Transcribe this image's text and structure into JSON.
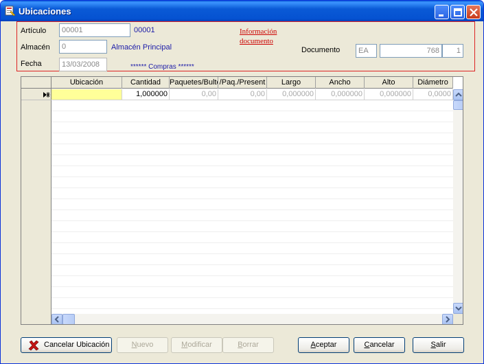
{
  "window": {
    "title": "Ubicaciones"
  },
  "header": {
    "articulo_label": "Artículo",
    "articulo_value": "00001",
    "articulo_desc": "00001",
    "almacen_label": "Almacén",
    "almacen_value": "0",
    "almacen_desc": "Almacén Principal",
    "fecha_label": "Fecha",
    "fecha_value": "13/03/2008",
    "tipo_desc": "****** Compras ******",
    "info_link_line1": "Información",
    "info_link_line2": "documento",
    "documento_label": "Documento",
    "doc_serie": "EA",
    "doc_numero": "768",
    "doc_linea": "1"
  },
  "grid": {
    "columns": [
      "Ubicación",
      "Cantidad",
      "Paquetes/Bulto",
      "/Paq./Present",
      "Largo",
      "Ancho",
      "Alto",
      "Diámetro"
    ],
    "rows": [
      [
        "",
        "1,000000",
        "0,00",
        "0,00",
        "0,000000",
        "0,000000",
        "0,000000",
        "0,0000"
      ]
    ]
  },
  "buttons": {
    "cancelar_ubicacion": "Cancelar Ubicación",
    "nuevo_first": "N",
    "nuevo_rest": "uevo",
    "modificar_first": "M",
    "modificar_rest": "odificar",
    "borrar_first": "B",
    "borrar_rest": "orrar",
    "aceptar_first": "A",
    "aceptar_rest": "ceptar",
    "cancelar_first": "C",
    "cancelar_rest": "ancelar",
    "salir_first": "S",
    "salir_rest": "alir"
  },
  "colors": {
    "accent": "#0a5ad6",
    "row_highlight": "#ffff99",
    "link_red": "#cc0000",
    "desc_blue": "#1a1aa8"
  }
}
